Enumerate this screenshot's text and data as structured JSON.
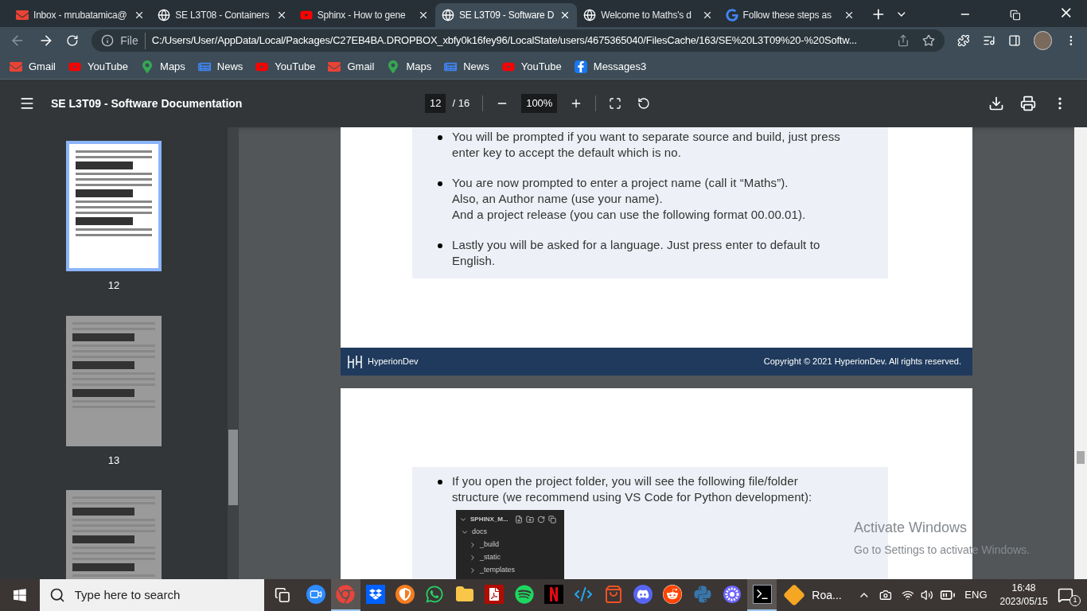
{
  "browser": {
    "tabs": [
      {
        "title": "Inbox - mrubatamica@",
        "kind": "mail",
        "selected": false
      },
      {
        "title": "SE L3T08 - Containers",
        "kind": "globe",
        "selected": false
      },
      {
        "title": "Sphinx - How to gene",
        "kind": "play",
        "selected": false
      },
      {
        "title": "SE L3T09 - Software D",
        "kind": "globe",
        "selected": true
      },
      {
        "title": "Welcome to Maths's d",
        "kind": "globe",
        "selected": false
      },
      {
        "title": "Follow these steps as",
        "kind": "google",
        "selected": false
      }
    ],
    "address": {
      "scheme": "File",
      "url": "C:/Users/User/AppData/Local/Packages/C27EB4BA.DROPBOX_xbfy0k16fey96/LocalState/users/4675365040/FilesCache/163/SE%20L3T09%20-%20Softw..."
    },
    "bookmarks": [
      {
        "label": "Gmail",
        "kind": "mail"
      },
      {
        "label": "YouTube",
        "kind": "play"
      },
      {
        "label": "Maps",
        "kind": "map"
      },
      {
        "label": "News",
        "kind": "news"
      },
      {
        "label": "YouTube",
        "kind": "play"
      },
      {
        "label": "Gmail",
        "kind": "mail"
      },
      {
        "label": "Maps",
        "kind": "map"
      },
      {
        "label": "News",
        "kind": "news"
      },
      {
        "label": "YouTube",
        "kind": "play"
      },
      {
        "label": "Messages3",
        "kind": "facebook"
      }
    ]
  },
  "pdf_toolbar": {
    "title": "SE L3T09 - Software Documentation",
    "page": "12",
    "total": "/ 16",
    "zoom": "100%"
  },
  "thumbnails": [
    {
      "page": "12",
      "selected": true
    },
    {
      "page": "13",
      "selected": false
    },
    {
      "selected": false
    }
  ],
  "page_1": {
    "bullets": [
      {
        "lines": [
          "You will be prompted if you want to separate source and build, just press",
          "enter key to accept the default which is no."
        ]
      },
      {
        "lines": [
          "You are now prompted to enter a project name (call it “Maths”).",
          "Also, an Author name (use your name).",
          "And a project release (you can use the following format 00.00.01)."
        ]
      },
      {
        "lines": [
          "Lastly you will be asked for a language. Just press enter to default to",
          "English."
        ]
      }
    ],
    "footer": {
      "brand": "HyperionDev",
      "copyright": "Copyright © 2021 HyperionDev. All rights reserved."
    }
  },
  "page_2": {
    "bullets": [
      {
        "lines": [
          "If you open the project folder, you will see the following file/folder",
          "structure (we recommend using VS Code for Python development):"
        ]
      }
    ],
    "explorer": {
      "header": "SPHINX_M...",
      "tree": [
        {
          "label": "docs",
          "expanded": true,
          "children": [
            {
              "label": "_build",
              "expanded": false
            },
            {
              "label": "_static",
              "expanded": false
            },
            {
              "label": "_templates",
              "expanded": false
            }
          ]
        }
      ]
    }
  },
  "watermark": {
    "title": "Activate Windows",
    "subtitle": "Go to Settings to activate Windows."
  },
  "taskbar": {
    "search_placeholder": "Type here to search",
    "apps": [
      {
        "kind": "zoom",
        "selected": false
      },
      {
        "kind": "chrome",
        "selected": true
      },
      {
        "kind": "dropbox",
        "selected": false
      },
      {
        "kind": "shield",
        "selected": false
      },
      {
        "kind": "whatsapp",
        "selected": false
      },
      {
        "kind": "folder",
        "selected": false
      },
      {
        "kind": "pdf",
        "selected": false
      },
      {
        "kind": "spotify",
        "selected": false
      },
      {
        "kind": "netflix",
        "selected": false
      },
      {
        "kind": "code",
        "selected": false
      },
      {
        "kind": "store",
        "selected": false
      },
      {
        "kind": "discord",
        "selected": false
      },
      {
        "kind": "reddit",
        "selected": false
      },
      {
        "kind": "python",
        "selected": false
      },
      {
        "kind": "flower",
        "selected": false
      },
      {
        "kind": "terminal",
        "selected": true
      }
    ],
    "running_app": "Roa...",
    "language": "ENG",
    "time": "16:48",
    "date": "2023/05/15",
    "notifications": "1"
  }
}
